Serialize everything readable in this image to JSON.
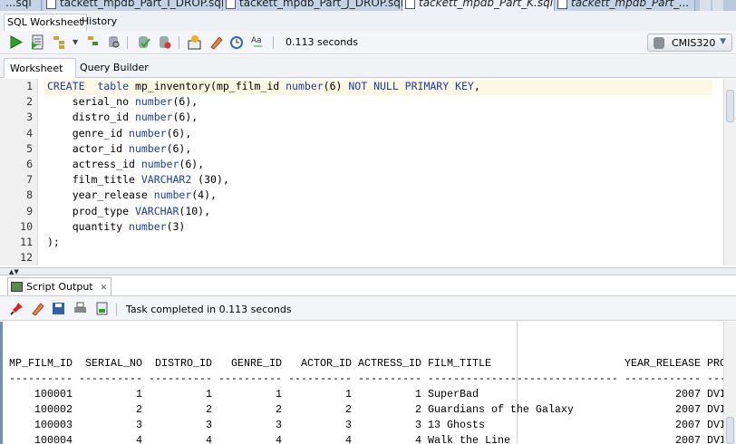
{
  "doc_tabs": [
    {
      "label": "...sql"
    },
    {
      "label": "tackett_mpdb_Part_I_DROP.sql"
    },
    {
      "label": "tackett_mpdb_Part_J_DROP.sql"
    },
    {
      "label": "tackett_mpdb_Part_K.sql",
      "active": true
    },
    {
      "label": "tackett_mpdb_Part_..."
    }
  ],
  "sql_tabs": [
    "SQL Worksheet",
    "History"
  ],
  "toolbar": {
    "elapsed": "0.113 seconds",
    "connection": "CMIS320"
  },
  "worksheet_tabs": [
    "Worksheet",
    "Query Builder"
  ],
  "editor": {
    "lines": [
      [
        [
          "kw",
          "CREATE"
        ],
        [
          "",
          "  "
        ],
        [
          "kw",
          "table"
        ],
        [
          "",
          " mp_inventory(mp_film_id "
        ],
        [
          "kw",
          "number"
        ],
        [
          "",
          "(6) "
        ],
        [
          "kw",
          "NOT NULL PRIMARY KEY"
        ],
        [
          "",
          ","
        ]
      ],
      [
        [
          "",
          "    serial_no "
        ],
        [
          "kw",
          "number"
        ],
        [
          "",
          "(6),"
        ]
      ],
      [
        [
          "",
          "    distro_id "
        ],
        [
          "kw",
          "number"
        ],
        [
          "",
          "(6),"
        ]
      ],
      [
        [
          "",
          "    genre_id "
        ],
        [
          "kw",
          "number"
        ],
        [
          "",
          "(6),"
        ]
      ],
      [
        [
          "",
          "    actor_id "
        ],
        [
          "kw",
          "number"
        ],
        [
          "",
          "(6),"
        ]
      ],
      [
        [
          "",
          "    actress_id "
        ],
        [
          "kw",
          "number"
        ],
        [
          "",
          "(6),"
        ]
      ],
      [
        [
          "",
          "    film_title "
        ],
        [
          "kw",
          "VARCHAR2"
        ],
        [
          "",
          " (30),"
        ]
      ],
      [
        [
          "",
          "    year_release "
        ],
        [
          "kw",
          "number"
        ],
        [
          "",
          "(4),"
        ]
      ],
      [
        [
          "",
          "    prod_type "
        ],
        [
          "kw",
          "VARCHAR"
        ],
        [
          "",
          "(10),"
        ]
      ],
      [
        [
          "",
          "    quantity "
        ],
        [
          "kw",
          "number"
        ],
        [
          "",
          "(3)"
        ]
      ],
      [
        [
          "",
          ");"
        ]
      ],
      [
        [
          "",
          ""
        ]
      ]
    ]
  },
  "output": {
    "tab_label": "Script Output",
    "status": "Task completed in 0.113 seconds",
    "columns": [
      "MP_FILM_ID",
      "SERIAL_NO",
      "DISTRO_ID",
      "GENRE_ID",
      "ACTOR_ID",
      "ACTRESS_ID",
      "FILM_TITLE",
      "YEAR_RELEASE",
      "PRO"
    ],
    "rows": [
      [
        "100001",
        "1",
        "1",
        "1",
        "1",
        "1",
        "SuperBad",
        "2007",
        "DVI"
      ],
      [
        "100002",
        "2",
        "2",
        "2",
        "2",
        "2",
        "Guardians of the Galaxy",
        "2007",
        "DVI"
      ],
      [
        "100003",
        "3",
        "3",
        "3",
        "3",
        "3",
        "13 Ghosts",
        "2007",
        "DVI"
      ],
      [
        "100004",
        "4",
        "4",
        "4",
        "4",
        "4",
        "Walk the Line",
        "2007",
        "DVI"
      ]
    ]
  },
  "colors": {
    "keyword": "#1c3ca8",
    "current_line": "#fdf8e4"
  }
}
